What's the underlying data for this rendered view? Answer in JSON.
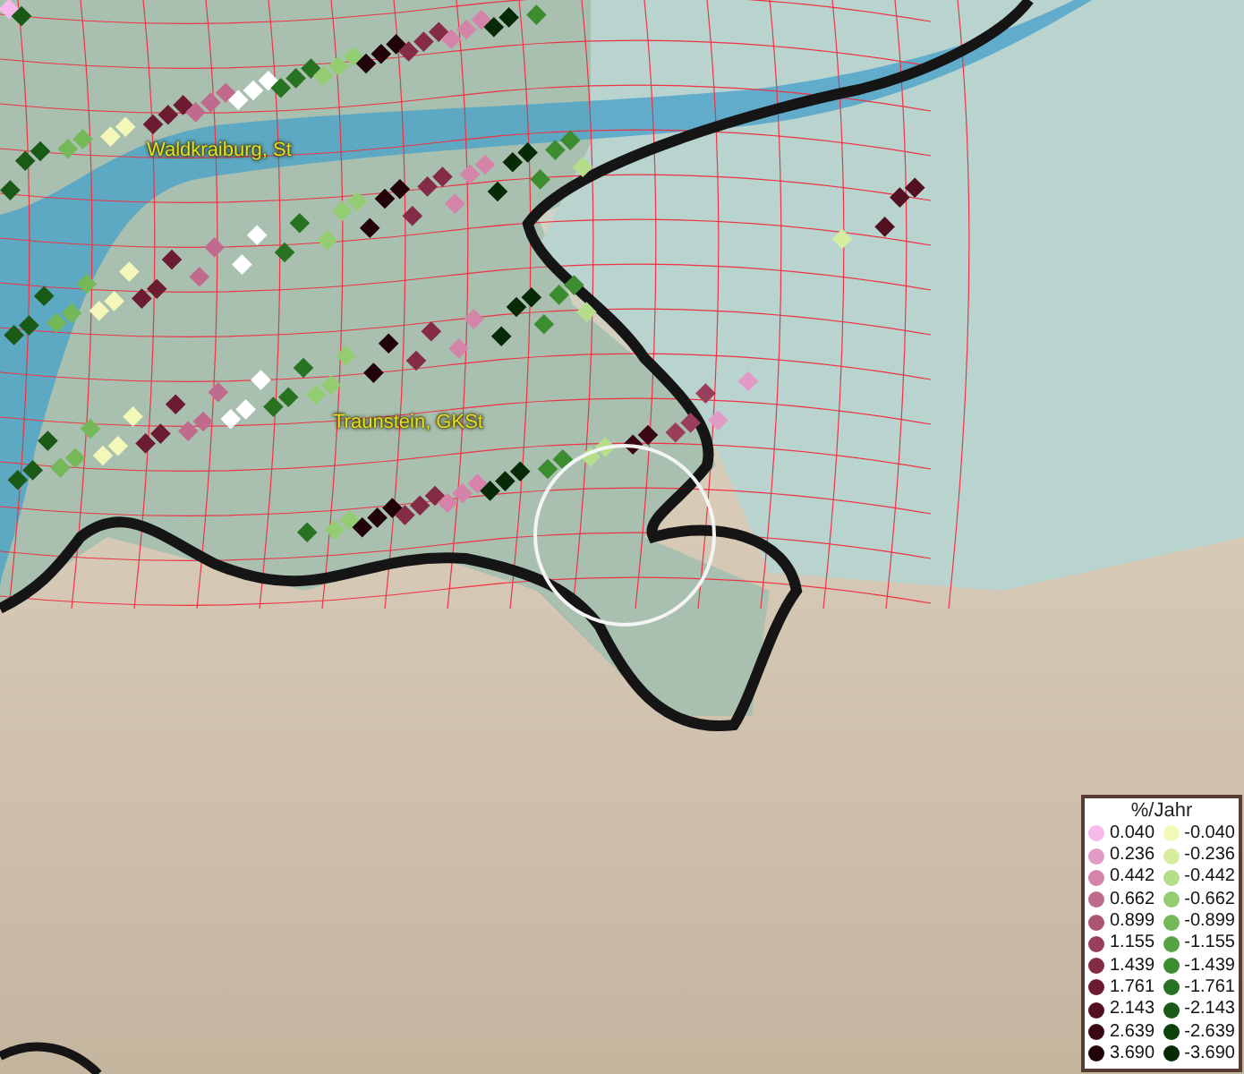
{
  "map": {
    "place_labels": [
      "Waldkraiburg, St",
      "Traunstein, GKSt"
    ]
  },
  "legend": {
    "title": "%/Jahr",
    "positive": [
      {
        "value": "0.040",
        "color": "#f7b8ea"
      },
      {
        "value": "0.236",
        "color": "#e29ac6"
      },
      {
        "value": "0.442",
        "color": "#d384a8"
      },
      {
        "value": "0.662",
        "color": "#c06b8e"
      },
      {
        "value": "0.899",
        "color": "#ad5474"
      },
      {
        "value": "1.155",
        "color": "#9a3f5b"
      },
      {
        "value": "1.439",
        "color": "#842c45"
      },
      {
        "value": "1.761",
        "color": "#6c1c31"
      },
      {
        "value": "2.143",
        "color": "#521020"
      },
      {
        "value": "2.639",
        "color": "#3a0814"
      },
      {
        "value": "3.690",
        "color": "#22030a"
      }
    ],
    "negative": [
      {
        "value": "-0.040",
        "color": "#f3f7b8"
      },
      {
        "value": "-0.236",
        "color": "#d6eda0"
      },
      {
        "value": "-0.442",
        "color": "#b4de8a"
      },
      {
        "value": "-0.662",
        "color": "#94cc72"
      },
      {
        "value": "-0.899",
        "color": "#74b858"
      },
      {
        "value": "-1.155",
        "color": "#55a342"
      },
      {
        "value": "-1.439",
        "color": "#3c8c30"
      },
      {
        "value": "-1.761",
        "color": "#287322"
      },
      {
        "value": "-2.143",
        "color": "#195a16"
      },
      {
        "value": "-2.639",
        "color": "#0e420d"
      },
      {
        "value": "-3.690",
        "color": "#052a05"
      }
    ]
  }
}
